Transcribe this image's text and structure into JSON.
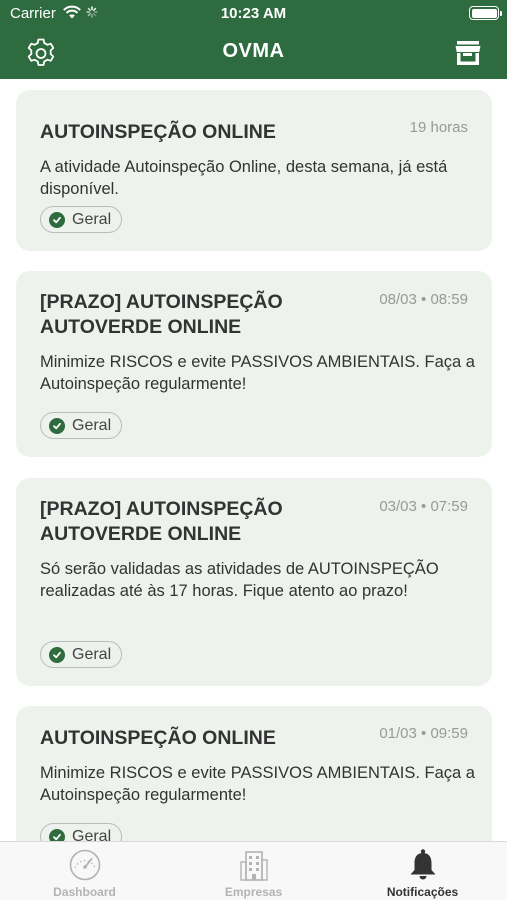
{
  "status_bar": {
    "carrier": "Carrier",
    "time": "10:23 AM"
  },
  "app_bar": {
    "title": "OVMA",
    "left_icon": "gear-icon",
    "right_icon": "store-icon"
  },
  "colors": {
    "brand": "#2e6b3e",
    "card": "#edf2ed",
    "text": "#333333",
    "muted": "#999999"
  },
  "notifications": [
    {
      "title": "AUTOINSPEÇÃO ONLINE",
      "time": "19 horas",
      "body": "A atividade Autoinspeção Online, desta semana, já está disponível.",
      "tag": "Geral"
    },
    {
      "title": "[PRAZO] AUTOINSPEÇÃO AUTOVERDE ONLINE",
      "time": "08/03 • 08:59",
      "body": "Minimize RISCOS e evite PASSIVOS AMBIENTAIS. Faça a Autoinspeção regularmente!",
      "tag": "Geral"
    },
    {
      "title": "[PRAZO] AUTOINSPEÇÃO AUTOVERDE ONLINE",
      "time": "03/03 • 07:59",
      "body": "Só serão validadas as atividades de AUTOINSPEÇÃO realizadas até às 17 horas. Fique atento ao prazo!",
      "tag": "Geral"
    },
    {
      "title": "AUTOINSPEÇÃO ONLINE",
      "time": "01/03 • 09:59",
      "body": "Minimize RISCOS e evite PASSIVOS AMBIENTAIS. Faça a Autoinspeção regularmente!",
      "tag": "Geral"
    }
  ],
  "tab_bar": {
    "tabs": [
      {
        "label": "Dashboard",
        "icon": "gauge-icon",
        "active": false
      },
      {
        "label": "Empresas",
        "icon": "building-icon",
        "active": false
      },
      {
        "label": "Notificações",
        "icon": "bell-icon",
        "active": true
      }
    ]
  }
}
